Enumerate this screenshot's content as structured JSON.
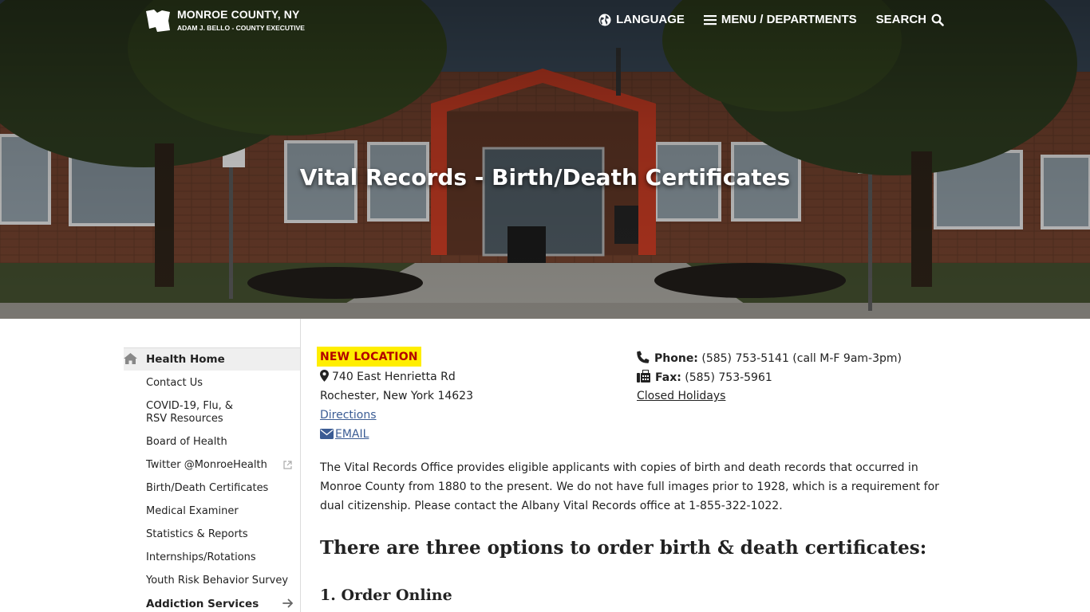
{
  "header": {
    "brand_name": "MONROE COUNTY, NY",
    "brand_sub": "ADAM J. BELLO - COUNTY EXECUTIVE",
    "nav": {
      "language": "LANGUAGE",
      "menu": "MENU / DEPARTMENTS",
      "search": "SEARCH"
    }
  },
  "hero": {
    "title": "Vital Records - Birth/Death Certificates"
  },
  "sidebar": {
    "items": [
      {
        "label": "Health Home"
      },
      {
        "label": "Contact Us"
      },
      {
        "label": "COVID-19, Flu, & RSV Resources"
      },
      {
        "label": "Board of Health"
      },
      {
        "label": "Twitter @MonroeHealth"
      },
      {
        "label": "Birth/Death Certificates"
      },
      {
        "label": "Medical Examiner"
      },
      {
        "label": "Statistics & Reports"
      },
      {
        "label": "Internships/Rotations"
      },
      {
        "label": "Youth Risk Behavior Survey"
      },
      {
        "label": "Addiction Services"
      }
    ]
  },
  "main": {
    "badge": "NEW LOCATION",
    "address_street": "740 East Henrietta Rd",
    "address_city": "Rochester, New York 14623",
    "directions": "Directions",
    "email": "EMAIL",
    "phone_label": "Phone:",
    "phone_value": "(585) 753-5141 (call M-F 9am-3pm)",
    "fax_label": "Fax:",
    "fax_value": "(585) 753-5961",
    "holidays": "Closed Holidays",
    "intro": "The Vital Records Office provides eligible applicants with copies of birth and death records that occurred in Monroe County from 1880 to the present. We do not have full images prior to 1928, which is a requirement for dual citizenship. Please contact the Albany Vital Records office at 1-855-322-1022.",
    "heading": "There are three options to order birth & death certificates:",
    "option1": "1. Order Online"
  },
  "colors": {
    "badge_bg": "#ffee00",
    "badge_text": "#b30000",
    "link": "#3b5c94"
  }
}
